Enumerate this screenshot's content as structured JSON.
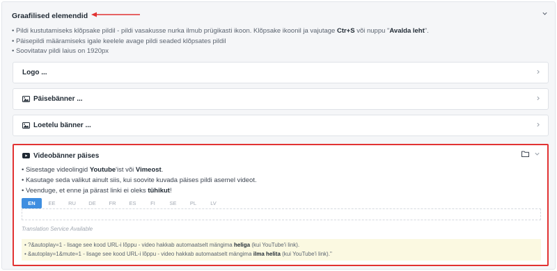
{
  "panel": {
    "title": "Graafilised elemendid",
    "notes": [
      {
        "pre": "• Pildi kustutamiseks klõpsake pildil - pildi vasakusse nurka ilmub prügikasti ikoon. Klõpsake ikoonil ja vajutage ",
        "b1": "Ctr+S",
        "mid": " või nuppu \"",
        "b2": "Avalda leht",
        "post": "\"."
      },
      {
        "text": "• Päisepildi määramiseks igale keelele avage pildi seaded klõpsates pildil"
      },
      {
        "text": "• Soovitatav pildi laius on 1920px"
      }
    ]
  },
  "cards": [
    {
      "label": "Logo ...",
      "icon": null
    },
    {
      "label": "Päisebänner ...",
      "icon": "image-icon"
    },
    {
      "label": "Loetelu bänner ...",
      "icon": "image-icon"
    }
  ],
  "video": {
    "title": "Videobänner päises",
    "notes": {
      "l1_pre": "• Sisestage videolingid ",
      "l1_b1": "Youtube",
      "l1_mid": "'ist või ",
      "l1_b2": "Vimeost",
      "l1_post": ".",
      "l2": "• Kasutage seda valikut ainult siis, kui soovite kuvada päises pildi asemel videot.",
      "l3_pre": "• Veenduge, et enne ja pärast linki ei oleks ",
      "l3_b": "tühikut",
      "l3_post": "!"
    },
    "languages": [
      "EN",
      "EE",
      "RU",
      "DE",
      "FR",
      "ES",
      "FI",
      "SE",
      "PL",
      "LV"
    ],
    "active_language": "EN",
    "input_value": "",
    "service_text": "Translation Service Available",
    "hint": {
      "l1_pre": "• ?&autoplay=1 - lisage see kood URL-i lõppu - video hakkab automaatselt mängima ",
      "l1_b": "heliga",
      "l1_post": " (kui YouTube'i link).",
      "l2_pre": "• &autoplay=1&mute=1 - lisage see kood URL-i lõppu - video hakkab automaatselt mängima ",
      "l2_b": "ilma helita",
      "l2_post": " (kui YouTube'i link).\""
    }
  },
  "colors": {
    "annotation": "#e23232",
    "active_tab": "#3f8ee0",
    "hint_bg": "#fbf9e1"
  }
}
